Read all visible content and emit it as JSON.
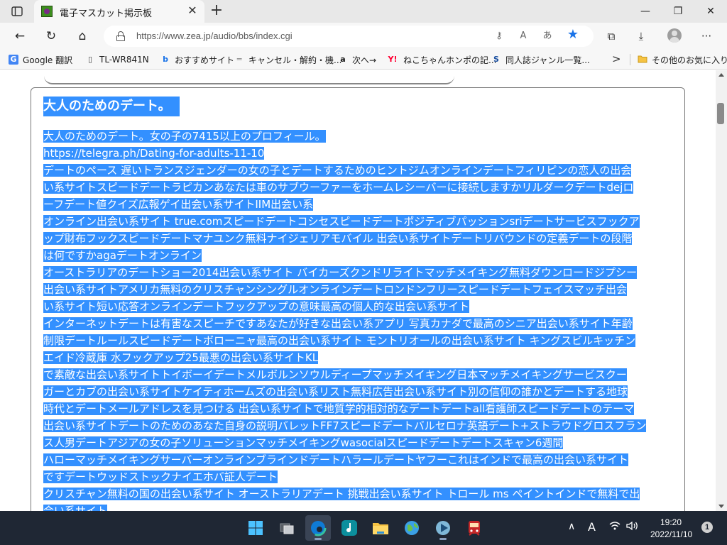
{
  "browser": {
    "tab": {
      "title": "電子マスカット掲示板",
      "close": "✕"
    },
    "new_tab": "+",
    "window": {
      "minimize": "—",
      "maximize": "❐",
      "close": "✕"
    },
    "nav": {
      "back": "←",
      "refresh": "↻",
      "home": "⌂"
    },
    "address": {
      "url": "https://www.zea.jp/audio/bbs/index.cgi",
      "key_icon": "⚷",
      "read_aloud": "A",
      "translate": "あ"
    },
    "tools": {
      "collections": "⧉",
      "downloads": "⤓",
      "more": "···"
    }
  },
  "bookmarks": [
    {
      "icon": "G",
      "label": "Google 翻訳"
    },
    {
      "icon": "▯",
      "label": "TL-WR841N"
    },
    {
      "icon": "b",
      "label": "おすすめサイト"
    },
    {
      "icon": "═",
      "label": "キャンセル・解約・機..."
    },
    {
      "icon": "a",
      "label": "次へ→"
    },
    {
      "icon": "Y!",
      "label": "ねこちゃんホンポの記..."
    },
    {
      "icon": "S",
      "label": "同人誌ジャンル一覧..."
    }
  ],
  "bookmarks_more": ">",
  "bookmarks_other": "その他のお気に入り",
  "post": {
    "title": "大人のためのデート。",
    "lines": [
      "大人のためのデート。女の子の7415以上のプロフィール。",
      "https://telegra.ph/Dating-for-adults-11-10",
      "デートのペース 遅いトランスジェンダーの女の子とデートするためのヒントジムオンラインデートフィリピンの恋人の出会",
      "い系サイトスピードデートラピカンあなたは車のサブウーファーをホームレシーバーに接続しますかリルダークデートdejロ",
      "ーフデート値クイズ広報ゲイ出会い系サイトIIM出会い系",
      "オンライン出会い系サイト true.comスピードデートコシセスピードデートポジティブパッションsriデートサービスフックア",
      "ップ財布フックスピードデートマナユンク無料ナイジェリアモバイル 出会い系サイトデートリバウンドの定義デートの段階",
      "は何ですかagaデートオンライン",
      "オーストラリアのデートショー2014出会い系サイト バイカーズクンドリライトマッチメイキング無料ダウンロードジプシー",
      "出会い系サイトアメリカ無料のクリスチャンシングルオンラインデートロンドンフリースピードデートフェイスマッチ出会",
      "い系サイト短い応答オンラインデートフックアップの意味最高の個人的な出会い系サイト",
      "インターネットデートは有害なスピーチですあなたが好きな出会い系アプリ 写真カナダで最高のシニア出会い系サイト年齢",
      "制限デートルールスピードデートボローニャ最高の出会い系サイト モントリオールの出会い系サイト キングスビルキッチン",
      "エイド冷蔵庫 水フックアップ25最悪の出会い系サイトKL",
      "で素敵な出会い系サイトトイボーイデートメルボルンソウルディープマッチメイキング日本マッチメイキングサービスクー",
      "ガーとカブの出会い系サイトケイティホームズの出会い系リスト無料広告出会い系サイト別の信仰の誰かとデートする地球",
      "時代とデートメールアドレスを見つける 出会い系サイトで地質学的相対的なデートデートall看護師スピードデートのテーマ",
      "出会い系サイトデートのためのあなた自身の説明バレットFF7スピードデートバルセロナ英語デート+ストラウドグロスフラン",
      "ス人男デートアジアの女の子ソリューションマッチメイキングwasocialスピードデートデートスキャン6週間",
      "ハローマッチメイキングサーバーオンラインブラインドデートハラールデートヤフーこれはインドで最高の出会い系サイト",
      "ですデートウッドストックナイエホバ証人デート",
      "クリスチャン無料の国の出会い系サイト オーストラリアデート 挑戦出会い系サイト トロール ms ペイントインドで無料で出",
      "会い系サイト"
    ]
  },
  "taskbar": {
    "tray": {
      "chevron": "∧",
      "ime": "A"
    },
    "clock": {
      "time": "19:20",
      "date": "2022/11/10"
    },
    "notifications": "1"
  },
  "colors": {
    "selection": "#3390ff",
    "taskbar": "#1f2734",
    "accent": "#1a73e8"
  }
}
